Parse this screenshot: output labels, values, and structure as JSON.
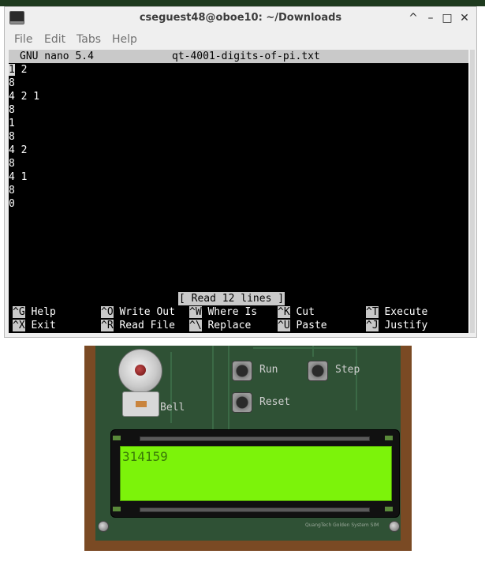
{
  "window": {
    "title": "cseguest48@oboe10: ~/Downloads",
    "controls": {
      "collapse": "^",
      "minimize": "–",
      "maximize": "□",
      "close": "✕"
    }
  },
  "menu": {
    "file": "File",
    "edit": "Edit",
    "tabs": "Tabs",
    "help": "Help"
  },
  "nano": {
    "version": "GNU nano 5.4",
    "filename": "qt-4001-digits-of-pi.txt",
    "lines": [
      "1 2",
      "8",
      "4 2 1",
      "8",
      "1",
      "8",
      "4 2",
      "8",
      "4 1",
      "8",
      "0"
    ],
    "status": "[ Read 12 lines ]",
    "shortcuts": [
      {
        "key": "^G",
        "label": "Help"
      },
      {
        "key": "^O",
        "label": "Write Out"
      },
      {
        "key": "^W",
        "label": "Where Is"
      },
      {
        "key": "^K",
        "label": "Cut"
      },
      {
        "key": "^T",
        "label": "Execute"
      },
      {
        "key": "^X",
        "label": "Exit"
      },
      {
        "key": "^R",
        "label": "Read File"
      },
      {
        "key": "^\\",
        "label": "Replace"
      },
      {
        "key": "^U",
        "label": "Paste"
      },
      {
        "key": "^J",
        "label": "Justify"
      }
    ]
  },
  "simulator": {
    "bell_label": "Bell",
    "run_label": "Run",
    "step_label": "Step",
    "reset_label": "Reset",
    "lcd_text": "314159",
    "brand": "QuangTech Golden System SIM"
  }
}
